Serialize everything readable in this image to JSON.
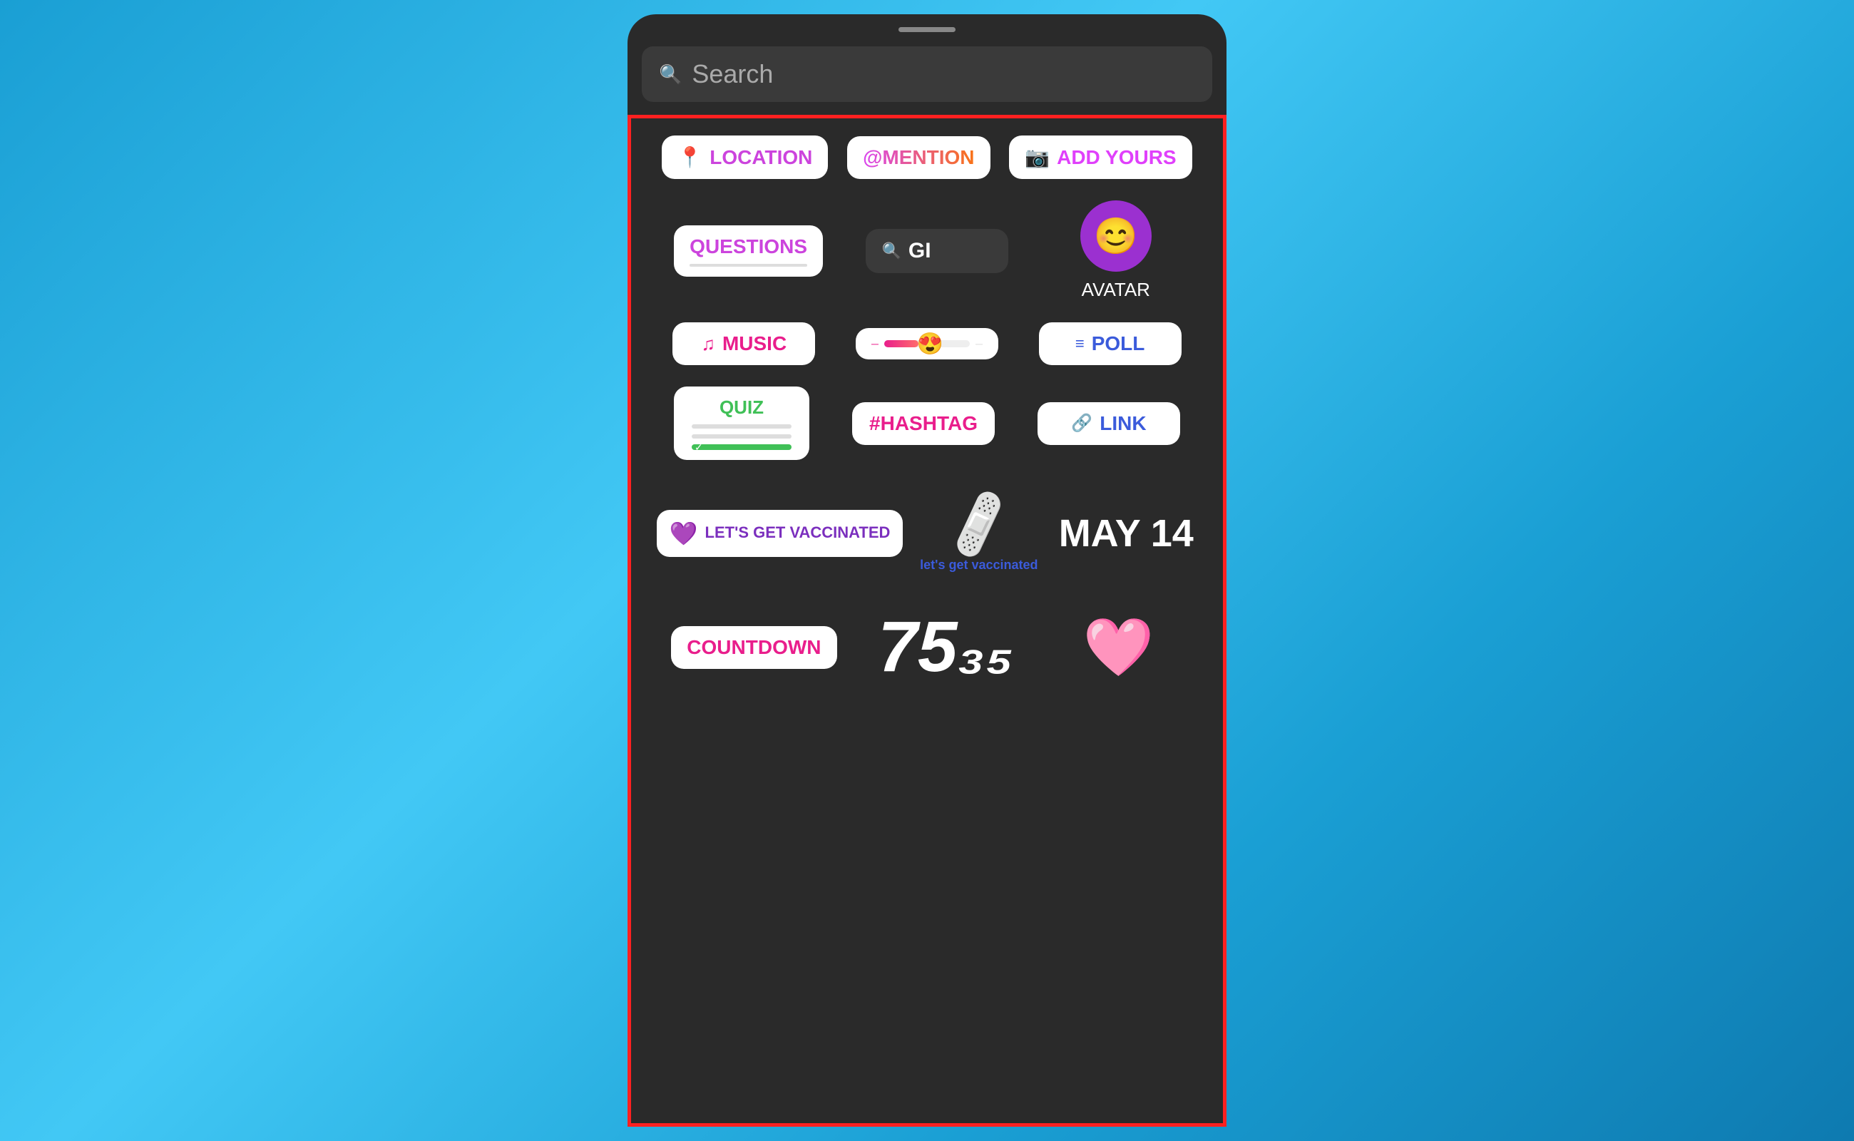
{
  "background": {
    "color": "#1a9fd4"
  },
  "top_bar": {
    "drag_handle": true,
    "search_placeholder": "Search"
  },
  "sticker_panel": {
    "border_color": "#ff2020",
    "row1": {
      "location_label": "LOCATION",
      "mention_label": "@MENTION",
      "addyours_label": "ADD YOURS"
    },
    "row2": {
      "questions_label": "QUESTIONS",
      "gif_label": "GI",
      "avatar_label": "AVATAR"
    },
    "row3": {
      "music_label": "MUSIC",
      "poll_label": "POLL"
    },
    "row4": {
      "quiz_label": "QUIZ",
      "hashtag_label": "#HASHTAG",
      "link_label": "LINK"
    },
    "row5": {
      "vaccinated_label": "LET'S GET VACCINATED",
      "bandaid_subtext": "let's get vaccinated",
      "may14_label": "MAY 14"
    },
    "row6": {
      "countdown_label": "COUNTDOWN",
      "number_display": "75₃₅",
      "heart_emoji": "🩷"
    }
  }
}
